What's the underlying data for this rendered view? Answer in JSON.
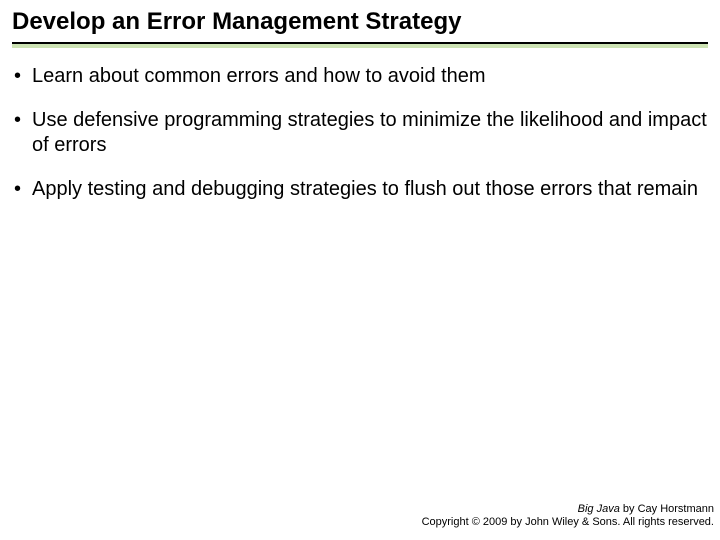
{
  "title": "Develop an Error Management Strategy",
  "bullets": [
    "Learn about common errors and how to avoid them",
    "Use defensive programming strategies to minimize the likelihood and impact of errors",
    "Apply testing and debugging strategies to flush out those errors that remain"
  ],
  "footer": {
    "book": "Big Java",
    "byline": " by Cay Horstmann",
    "copyright": "Copyright © 2009 by John Wiley & Sons. All rights reserved."
  }
}
